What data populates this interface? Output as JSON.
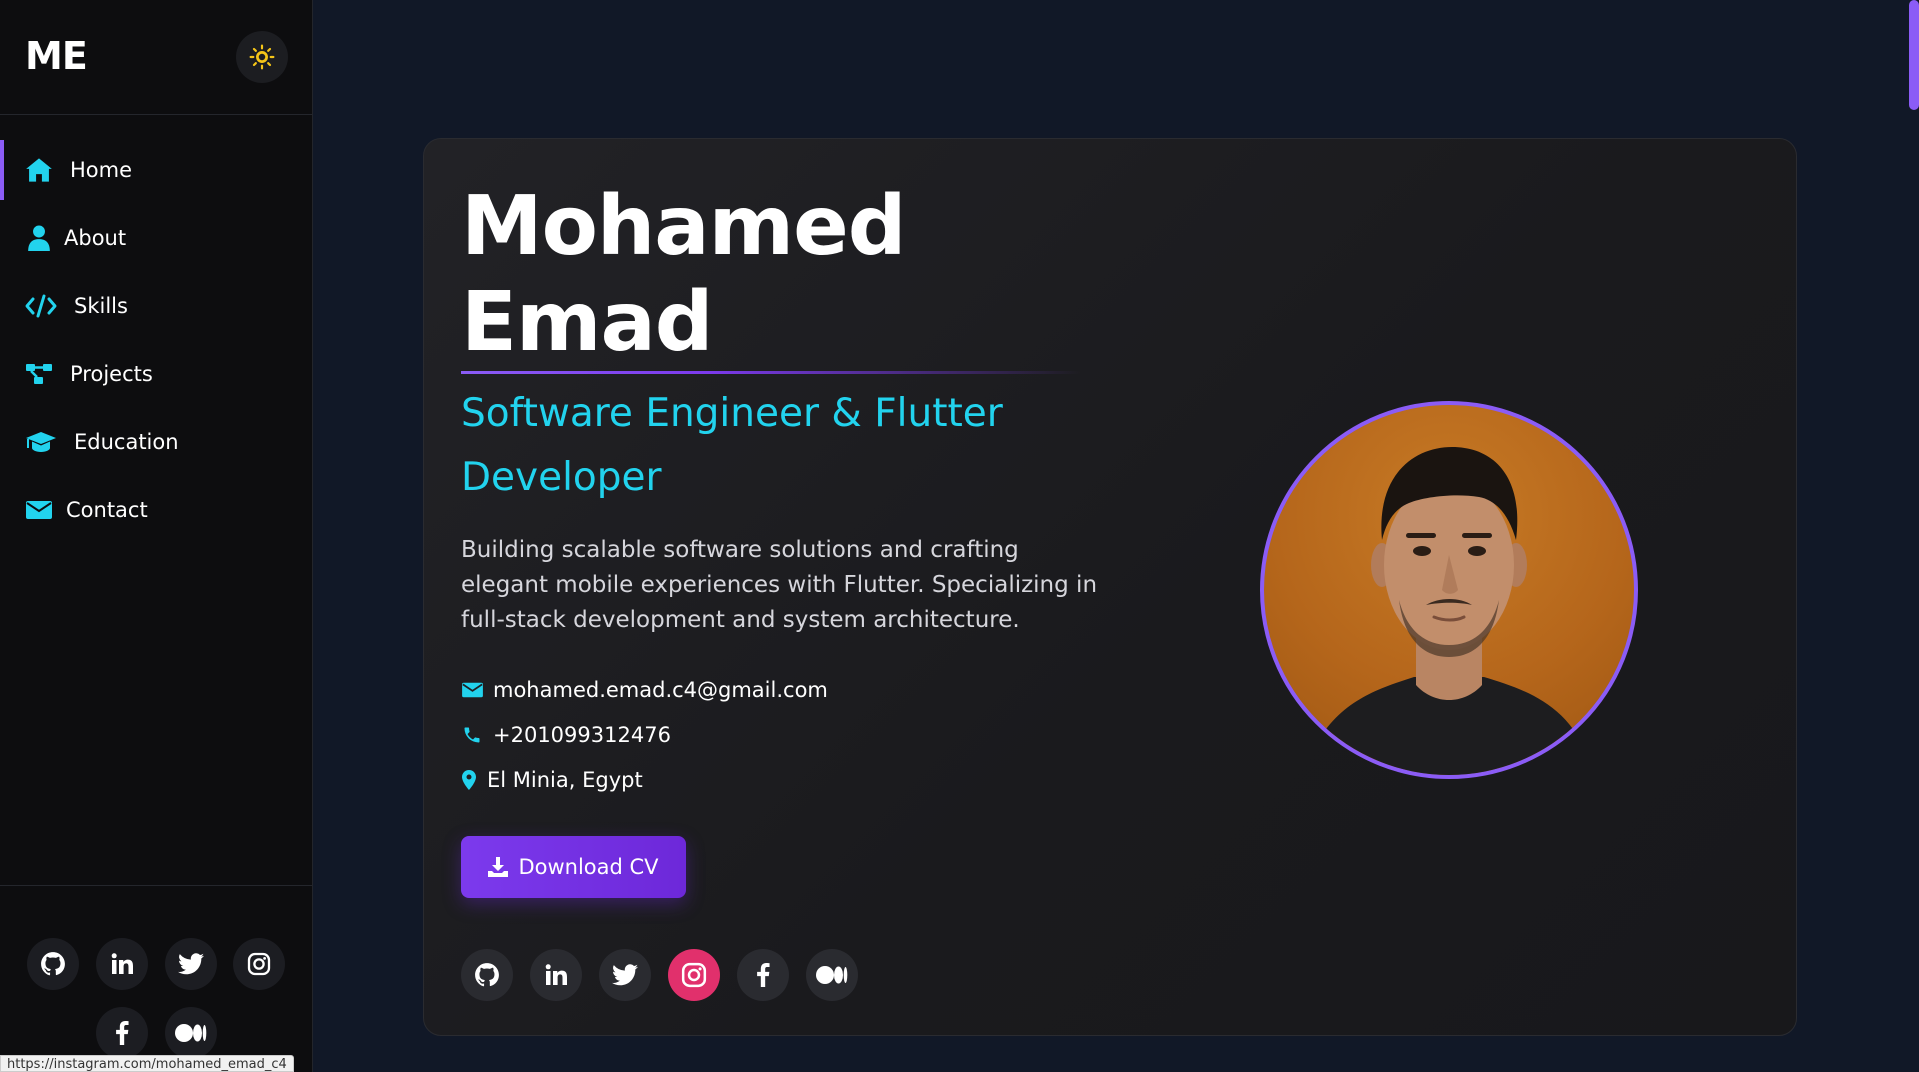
{
  "sidebar": {
    "logo": "ME",
    "nav": [
      {
        "label": "Home",
        "icon": "home-icon",
        "active": true
      },
      {
        "label": "About",
        "icon": "user-icon",
        "active": false
      },
      {
        "label": "Skills",
        "icon": "code-icon",
        "active": false
      },
      {
        "label": "Projects",
        "icon": "project-diagram-icon",
        "active": false
      },
      {
        "label": "Education",
        "icon": "graduation-cap-icon",
        "active": false
      },
      {
        "label": "Contact",
        "icon": "envelope-icon",
        "active": false
      }
    ],
    "socials": [
      "github-icon",
      "linkedin-icon",
      "twitter-icon",
      "instagram-icon",
      "facebook-icon",
      "medium-icon"
    ]
  },
  "status_bar": {
    "url": "https://instagram.com/mohamed_emad_c4"
  },
  "hero": {
    "name": "Mohamed Emad",
    "role": "Software Engineer & Flutter Developer",
    "description": "Building scalable software solutions and crafting elegant mobile experiences with Flutter. Specializing in full-stack development and system architecture.",
    "email": "mohamed.emad.c4@gmail.com",
    "phone": "+201099312476",
    "location": "El Minia, Egypt",
    "cv_label": "Download CV",
    "socials": [
      "github-icon",
      "linkedin-icon",
      "twitter-icon",
      "instagram-icon",
      "facebook-icon",
      "medium-icon"
    ]
  },
  "colors": {
    "accent": "#8b5cf6",
    "cyan": "#22d3ee",
    "background": "#111827",
    "instagram": "#e1306c"
  }
}
